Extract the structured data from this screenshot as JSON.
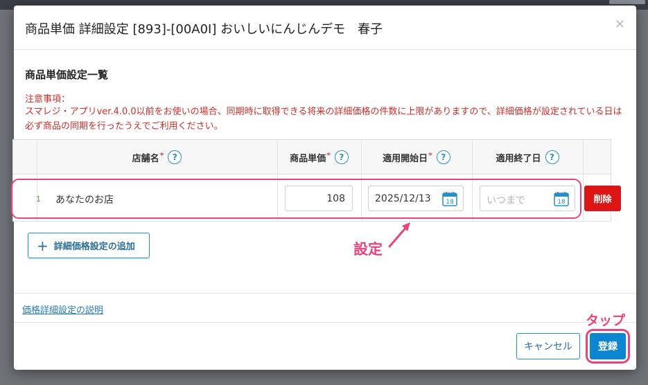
{
  "modal": {
    "title": "商品単価 詳細設定 [893]-[00A0I] おいしいにんじんデモ　春子",
    "close": "×"
  },
  "section": {
    "title": "商品単価設定一覧"
  },
  "notice": {
    "heading": "注意事項：",
    "body": "スマレジ・アプリver.4.0.0以前をお使いの場合、同期時に取得できる将来の詳細価格の件数に上限がありますので、詳細価格が設定されている日は必ず商品の同期を行ったうえでご利用ください。"
  },
  "table": {
    "headers": {
      "store": "店舗名",
      "price": "商品単価",
      "start": "適用開始日",
      "end": "適用終了日"
    },
    "required_mark": "*",
    "help_glyph": "?",
    "rows": [
      {
        "num": "1",
        "store": "あなたのお店",
        "price": "108",
        "start_date": "2025/12/13",
        "end_placeholder": "いつまで",
        "calendar_day": "18",
        "delete_label": "削除"
      }
    ]
  },
  "add_button": {
    "plus": "+",
    "label": "詳細価格設定の追加"
  },
  "annotations": {
    "setting": "設定",
    "tap": "タップ"
  },
  "footer": {
    "help_link": "価格詳細設定の説明",
    "cancel": "キャンセル",
    "register": "登録"
  },
  "colors": {
    "accent_blue": "#2a8ec4",
    "primary_button": "#0d86d2",
    "danger": "#dc1414",
    "warning_text": "#c9302c",
    "annotation_pink": "#e8457f"
  }
}
